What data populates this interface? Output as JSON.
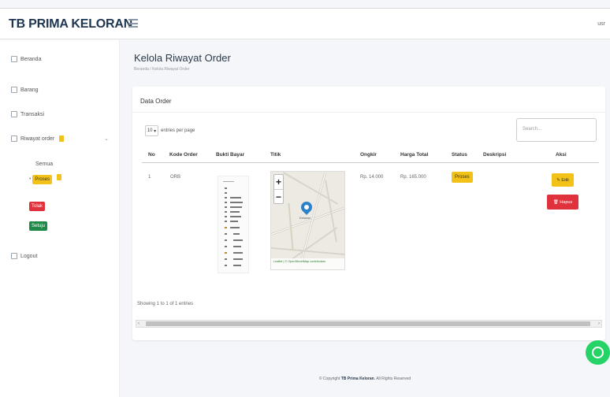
{
  "header": {
    "brand": "TB PRIMA KELORAN",
    "user": "usr"
  },
  "sidebar": {
    "items": [
      {
        "label": "Beranda"
      },
      {
        "label": "Barang"
      },
      {
        "label": "Transaksi"
      },
      {
        "label": "Riwayat order"
      },
      {
        "label": "Logout"
      }
    ],
    "sub_items": [
      {
        "label": "Semua"
      },
      {
        "label": "Proses"
      },
      {
        "label": "Tolak"
      },
      {
        "label": "Setuju"
      }
    ]
  },
  "page": {
    "title": "Kelola Riwayat Order",
    "breadcrumb": "Beranda / Kelola Riwayat Order"
  },
  "card": {
    "title": "Data Order",
    "entries_value": "10",
    "entries_label": "entries per page",
    "search_placeholder": "Search...",
    "columns": [
      "No",
      "Kode Order",
      "Bukti Bayar",
      "Titik",
      "Ongkir",
      "Harga Total",
      "Status",
      "Deskripsi",
      "Aksi"
    ],
    "rows": [
      {
        "no": "1",
        "kode_order": "ORB",
        "ongkir": "Rp. 14.000",
        "harga_total": "Rp. 165.000",
        "status": "Proses",
        "deskripsi": "",
        "edit_label": "Edit",
        "delete_label": "Hapus"
      }
    ],
    "map": {
      "pin_label": "Keloran",
      "attribution": "Leaflet | © OpenStreetMap contributors"
    },
    "showing": "Showing 1 to 1 of 1 entries"
  },
  "footer": {
    "prefix": "© Copyright",
    "brand": "TB Prima Keloran",
    "suffix": ". All Rights Reserved"
  },
  "colors": {
    "warning": "#f2c218",
    "danger": "#e0323c",
    "success": "#1e8a4a",
    "whatsapp": "#25d366"
  }
}
